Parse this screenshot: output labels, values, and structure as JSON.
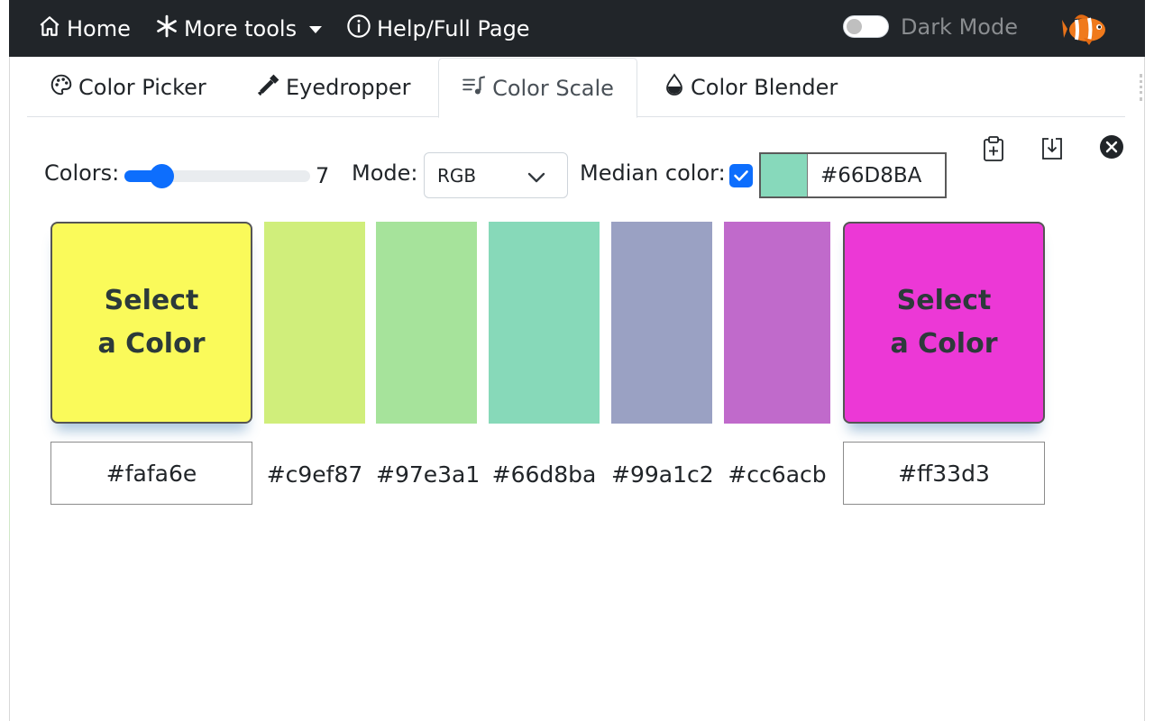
{
  "navbar": {
    "home_label": "Home",
    "more_tools_label": "More tools",
    "help_label": "Help/Full Page",
    "dark_mode_label": "Dark Mode",
    "dark_mode_on": false
  },
  "tabs": [
    {
      "label": "Color Picker",
      "icon": "palette-icon",
      "active": false
    },
    {
      "label": "Eyedropper",
      "icon": "eyedropper-icon",
      "active": false
    },
    {
      "label": "Color Scale",
      "icon": "music-list-icon",
      "active": true
    },
    {
      "label": "Color Blender",
      "icon": "droplet-icon",
      "active": false
    }
  ],
  "controls": {
    "colors_label": "Colors:",
    "colors_value": "7",
    "colors_slider_fraction": 0.2,
    "mode_label": "Mode:",
    "mode_value": "RGB",
    "median_label": "Median color:",
    "median_checked": true,
    "median_hex": "#66D8BA",
    "median_color": "#87d9bb"
  },
  "scale": {
    "start": {
      "label_line1": "Select",
      "label_line2": "a Color",
      "hex": "#fafa6e",
      "color": "#fafa5a"
    },
    "end": {
      "label_line1": "Select",
      "label_line2": "a Color",
      "hex": "#ff33d3",
      "color": "#ec38d6"
    },
    "steps": [
      {
        "hex": "#c9ef87",
        "color": "#d0ee7b"
      },
      {
        "hex": "#97e3a1",
        "color": "#a6e39b"
      },
      {
        "hex": "#66d8ba",
        "color": "#87d9b9"
      },
      {
        "hex": "#99a1c2",
        "color": "#9aa1c3"
      },
      {
        "hex": "#cc6acb",
        "color": "#c06acb"
      }
    ]
  }
}
